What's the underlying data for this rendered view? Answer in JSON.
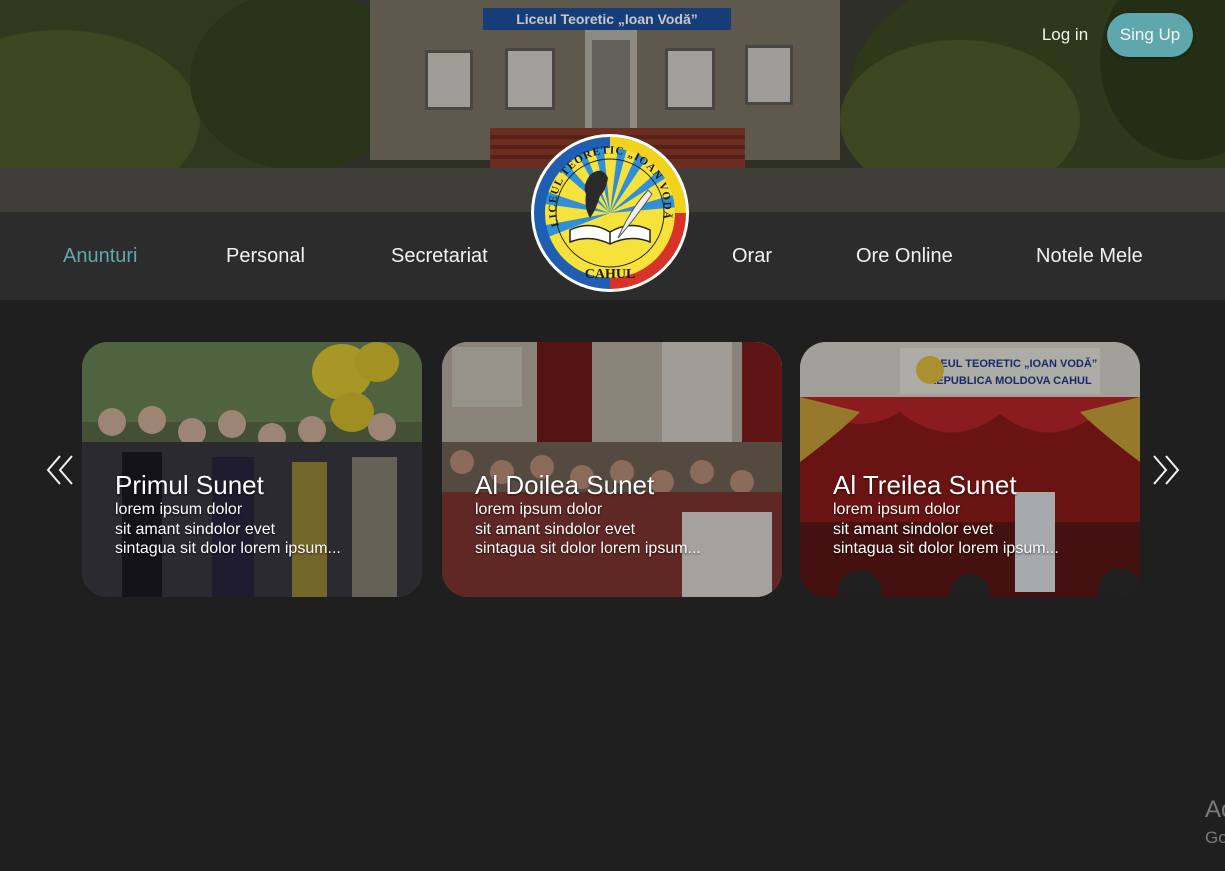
{
  "header": {
    "banner_text": "Liceul Teoretic „Ioan Vodă”",
    "login_label": "Log in",
    "signup_label": "Sing Up"
  },
  "logo": {
    "top_text": "LICEUL TEORETIC „IOAN VODĂ”",
    "bottom_text": "CAHUL"
  },
  "nav": {
    "items": [
      {
        "label": "Anunturi",
        "active": true
      },
      {
        "label": "Personal",
        "active": false
      },
      {
        "label": "Secretariat",
        "active": false
      },
      {
        "label": "Orar",
        "active": false
      },
      {
        "label": "Ore Online",
        "active": false
      },
      {
        "label": "Notele Mele",
        "active": false
      }
    ]
  },
  "carousel": {
    "prev_icon": "double-chevron-left-icon",
    "next_icon": "double-chevron-right-icon",
    "cards": [
      {
        "title": "Primul Sunet",
        "lines": [
          "lorem ipsum dolor",
          "sit amant sindolor evet",
          "sintagua sit dolor lorem ipsum..."
        ]
      },
      {
        "title": "Al Doilea Sunet",
        "lines": [
          "lorem ipsum dolor",
          "sit amant sindolor evet",
          "sintagua sit dolor lorem ipsum..."
        ]
      },
      {
        "title": "Al Treilea Sunet",
        "lines": [
          "lorem ipsum dolor",
          "sit amant sindolor evet",
          "sintagua sit dolor lorem ipsum..."
        ]
      }
    ],
    "card3_banner": [
      "LICEUL TEORETIC „IOAN VODĂ”",
      "REPUBLICA MOLDOVA CAHUL"
    ]
  },
  "watermark": {
    "line1": "Ac",
    "line2": "Go"
  },
  "colors": {
    "accent": "#5fa7ad",
    "nav_bg": "#2c2c2c",
    "page_bg": "#1f1f1f"
  }
}
